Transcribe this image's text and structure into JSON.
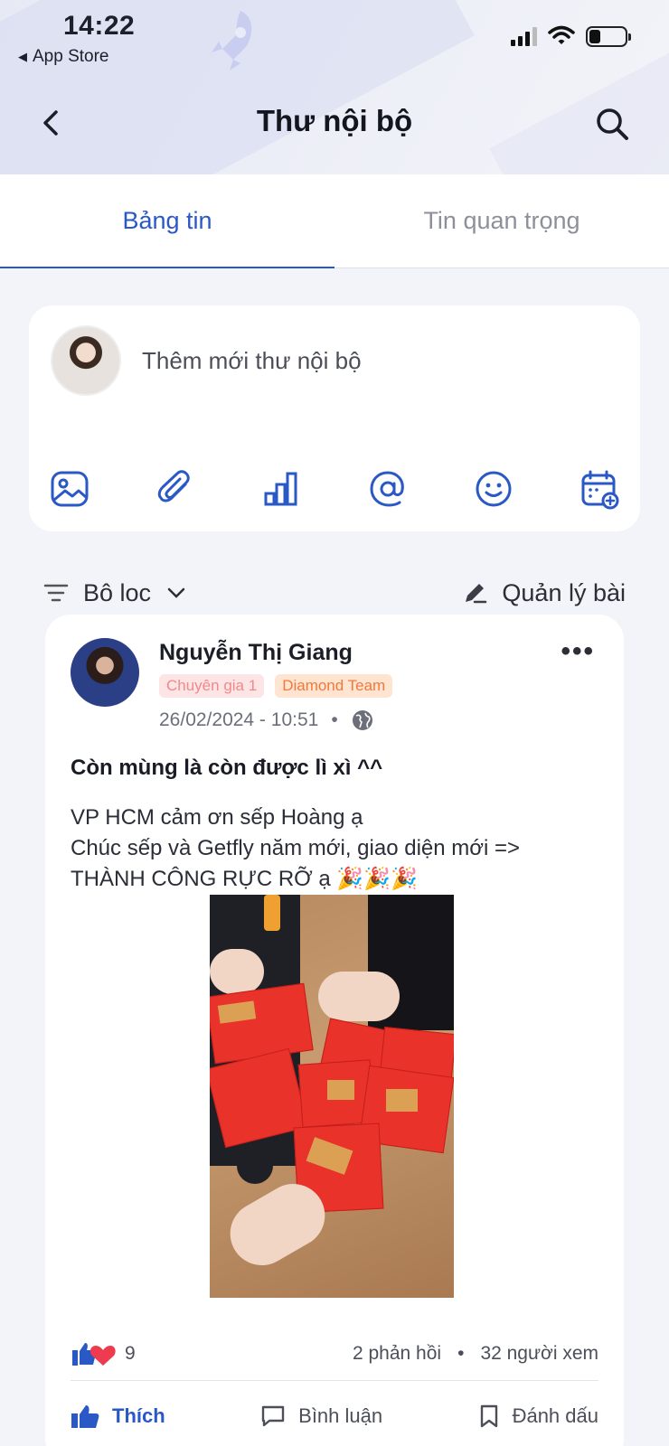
{
  "status_bar": {
    "time": "14:22",
    "back_app": "App Store"
  },
  "header": {
    "title": "Thư nội bộ"
  },
  "tabs": [
    {
      "label": "Bảng tin",
      "active": true
    },
    {
      "label": "Tin quan trọng",
      "active": false
    }
  ],
  "composer": {
    "placeholder": "Thêm mới thư nội bộ",
    "tools": [
      "image-icon",
      "attachment-icon",
      "poll-chart-icon",
      "mention-icon",
      "emoji-icon",
      "schedule-calendar-icon"
    ]
  },
  "filter": {
    "label": "Bô loc",
    "manage_label": "Quản lý bài"
  },
  "post": {
    "author": "Nguyễn Thị Giang",
    "badges": [
      "Chuyên gia 1",
      "Diamond Team"
    ],
    "date": "26/02/2024 - 10:51",
    "separator": "•",
    "title": "Còn mùng là còn được lì xì ^^",
    "body_lines": [
      "VP HCM cảm ơn sếp Hoàng ạ",
      "Chúc sếp và Getfly năm mới, giao diện mới =>",
      "THÀNH CÔNG RỰC RỠ ạ 🎉🎉🎉"
    ],
    "reaction_count": "9",
    "comments": "2 phản hồi",
    "views": "32 người xem",
    "actions": {
      "like": "Thích",
      "comment": "Bình luận",
      "bookmark": "Đánh dấu"
    }
  },
  "colors": {
    "accent": "#2a58c4",
    "badge_pink": "#f08a8a",
    "badge_orange": "#f07a3a",
    "like_red": "#ef3b4f"
  }
}
